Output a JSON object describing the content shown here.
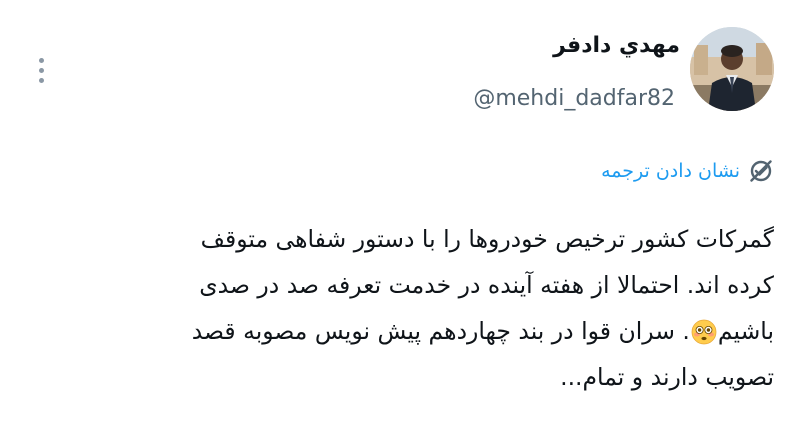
{
  "author": {
    "display_name": "مهدي دادفر",
    "handle": "@mehdi_dadfar82",
    "avatar_icon": "profile-photo"
  },
  "actions": {
    "more_icon": "more-vertical-icon",
    "translate_label": "نشان دادن ترجمه",
    "translate_icon": "translate-icon"
  },
  "tweet": {
    "lines": [
      "گمرکات کشور ترخیص خودروها را با دستور شفاهی متوقف",
      "کرده اند. احتمالا از هفته آینده در خدمت تعرفه صد در صدی",
      "باشیم",
      "سران قوا در بند چهاردهم پیش نویس مصوبه قصد",
      "تصویب دارند و تمام..."
    ],
    "line3_separator": ".",
    "emoji": "flushed-face-emoji"
  },
  "colors": {
    "text": "#0f1419",
    "secondary": "#536471",
    "accent": "#1d9bf0",
    "background": "#ffffff"
  }
}
